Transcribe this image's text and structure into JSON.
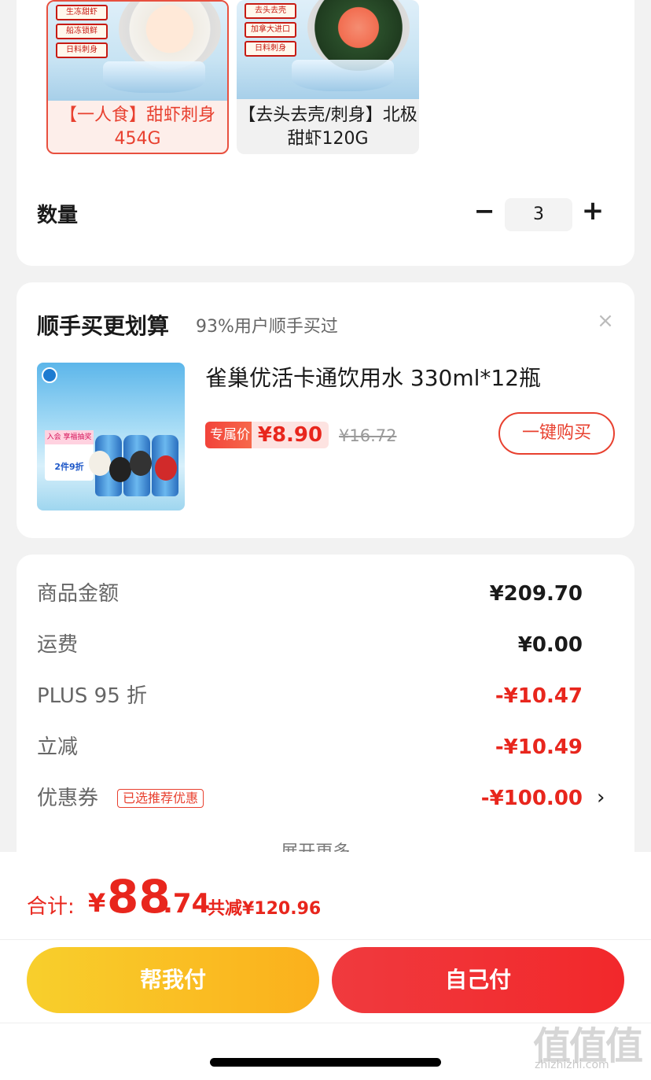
{
  "sku_options": [
    {
      "tags": [
        "生冻甜虾",
        "船冻锁鲜",
        "日料刺身"
      ],
      "name": "【一人食】甜虾刺身 454G",
      "selected": true
    },
    {
      "tags": [
        "去头去壳",
        "加拿大进口",
        "日料刺身"
      ],
      "name": "【去头去壳/刺身】北极甜虾120G",
      "selected": false
    }
  ],
  "quantity": {
    "label": "数量",
    "minus": "−",
    "value": "3",
    "plus": "+"
  },
  "recommend": {
    "title": "顺手买更划算",
    "subtitle": "93%用户顺手买过",
    "close": "×",
    "product": {
      "badge_top": "入会 享福抽奖",
      "badge_main": "2件9折",
      "name": "雀巢优活卡通饮用水 330ml*12瓶",
      "tag": "专属价",
      "price": "¥8.90",
      "original_price": "¥16.72",
      "buy_label": "一键购买"
    }
  },
  "summary": {
    "rows": [
      {
        "label": "商品金额",
        "value": "¥209.70"
      },
      {
        "label": "运费",
        "value": "¥0.00"
      },
      {
        "label": "PLUS 95 折",
        "value": "-¥10.47"
      },
      {
        "label": "立减",
        "value": "-¥10.49"
      },
      {
        "label": "优惠券",
        "chip": "已选推荐优惠",
        "value": "-¥100.00"
      }
    ],
    "chevron": "›",
    "expand_label": "展开更多 ⌄"
  },
  "footer": {
    "total_label": "合计:",
    "currency": "¥",
    "total_int": "88",
    "total_dec": ".74",
    "saved": "共减¥120.96",
    "help_pay": "帮我付",
    "self_pay": "自己付"
  },
  "watermark": {
    "mark": "值值值",
    "url": "zhizhizhi.com"
  },
  "colors": {
    "accent_red": "#e8261d",
    "help_btn": "#f8cf2c",
    "self_btn": "#f03a3e"
  }
}
